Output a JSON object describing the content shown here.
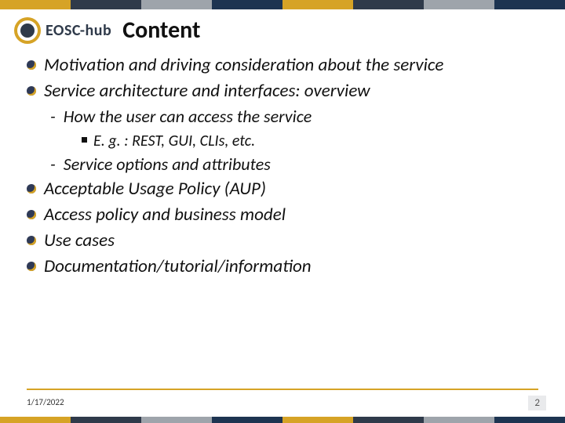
{
  "logo": {
    "text": "EOSC-hub"
  },
  "title": "Content",
  "bullets": {
    "b1": "Motivation and driving consideration about the service",
    "b2": "Service architecture and interfaces: overview",
    "b2a": "How the user can access the service",
    "b2a1": "E. g. : REST, GUI, CLIs, etc.",
    "b2b": "Service options and attributes",
    "b3": "Acceptable Usage Policy (AUP)",
    "b4": "Access policy and business model",
    "b5": "Use cases",
    "b6": "Documentation/tutorial/information"
  },
  "footer": {
    "date": "1/17/2022",
    "page": "2"
  }
}
